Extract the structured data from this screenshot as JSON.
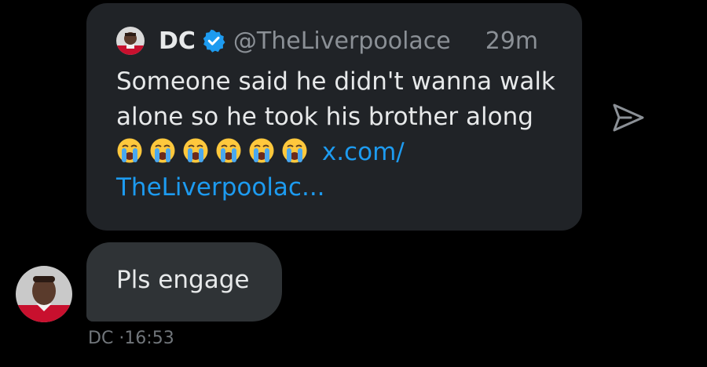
{
  "quote": {
    "name": "DC",
    "handle": "@TheLiverpoolace",
    "time": "29m",
    "text_line1": "Someone said he didn't wanna walk",
    "text_line2": "alone so he took his brother along",
    "emoji": [
      "loudly-crying-face",
      "loudly-crying-face",
      "loudly-crying-face",
      "loudly-crying-face",
      "loudly-crying-face",
      "loudly-crying-face"
    ],
    "link_part1": "x.com/",
    "link_part2": "TheLiverpoolac..."
  },
  "message": {
    "text": "Pls engage",
    "sender": "DC",
    "separator": "·",
    "time": "16:53"
  },
  "colors": {
    "background": "#000000",
    "quote_card": "#202327",
    "bubble": "#2f3336",
    "link": "#1d9bf0",
    "verified": "#1d9bf0",
    "muted": "#8b9096"
  },
  "icons": {
    "verified": "verified-badge-icon",
    "share": "send-icon"
  }
}
